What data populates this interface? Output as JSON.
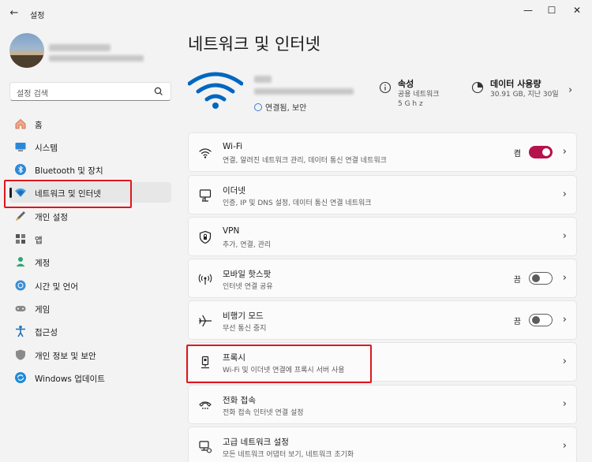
{
  "window": {
    "title": "설정",
    "back_icon": "back-arrow-icon",
    "minimize": "—",
    "maximize": "☐",
    "close": "✕"
  },
  "sidebar": {
    "search_placeholder": "설정 검색",
    "items": [
      {
        "label": "홈",
        "icon": "home-icon",
        "active": false
      },
      {
        "label": "시스템",
        "icon": "system-icon",
        "active": false
      },
      {
        "label": "Bluetooth 및 장치",
        "icon": "bluetooth-icon",
        "active": false
      },
      {
        "label": "네트워크 및 인터넷",
        "icon": "network-icon",
        "active": true
      },
      {
        "label": "개인 설정",
        "icon": "personalization-icon",
        "active": false
      },
      {
        "label": "앱",
        "icon": "apps-icon",
        "active": false
      },
      {
        "label": "계정",
        "icon": "account-icon",
        "active": false
      },
      {
        "label": "시간 및 언어",
        "icon": "time-language-icon",
        "active": false
      },
      {
        "label": "게임",
        "icon": "gaming-icon",
        "active": false
      },
      {
        "label": "접근성",
        "icon": "accessibility-icon",
        "active": false
      },
      {
        "label": "개인 정보 및 보안",
        "icon": "privacy-icon",
        "active": false
      },
      {
        "label": "Windows 업데이트",
        "icon": "update-icon",
        "active": false
      }
    ]
  },
  "main": {
    "title": "네트워크 및 인터넷",
    "status": "연결됨, 보안",
    "properties": {
      "title": "속성",
      "sub1": "공용 네트워크",
      "sub2": "5 G h z"
    },
    "data_usage": {
      "title": "데이터 사용량",
      "sub": "30.91 GB, 지난 30일"
    },
    "cards": [
      {
        "title": "Wi-Fi",
        "sub": "연결, 알려진 네트워크 관리, 데이터 통신 연결 네트워크",
        "icon": "wifi-icon",
        "toggle": "켬"
      },
      {
        "title": "이더넷",
        "sub": "인증, IP 및 DNS 설정, 데이터 통신 연결 네트워크",
        "icon": "ethernet-icon"
      },
      {
        "title": "VPN",
        "sub": "추가, 연결, 관리",
        "icon": "vpn-shield-icon"
      },
      {
        "title": "모바일 핫스팟",
        "sub": "인터넷 연결 공유",
        "icon": "hotspot-icon",
        "toggle": "끔"
      },
      {
        "title": "비행기 모드",
        "sub": "무선 통신 중지",
        "icon": "airplane-icon",
        "toggle": "끔"
      },
      {
        "title": "프록시",
        "sub": "Wi-Fi 및 이더넷 연결에 프록시 서버 사용",
        "icon": "proxy-icon"
      },
      {
        "title": "전화 접속",
        "sub": "전화 접속 인터넷 연결 설정",
        "icon": "dialup-icon"
      },
      {
        "title": "고급 네트워크 설정",
        "sub": "모든 네트워크 어댑터 보기, 네트워크 초기화",
        "icon": "advanced-network-icon"
      }
    ]
  },
  "colors": {
    "accent": "#b5134b",
    "wifi_blue": "#0067c0",
    "highlight": "#e0161d"
  }
}
